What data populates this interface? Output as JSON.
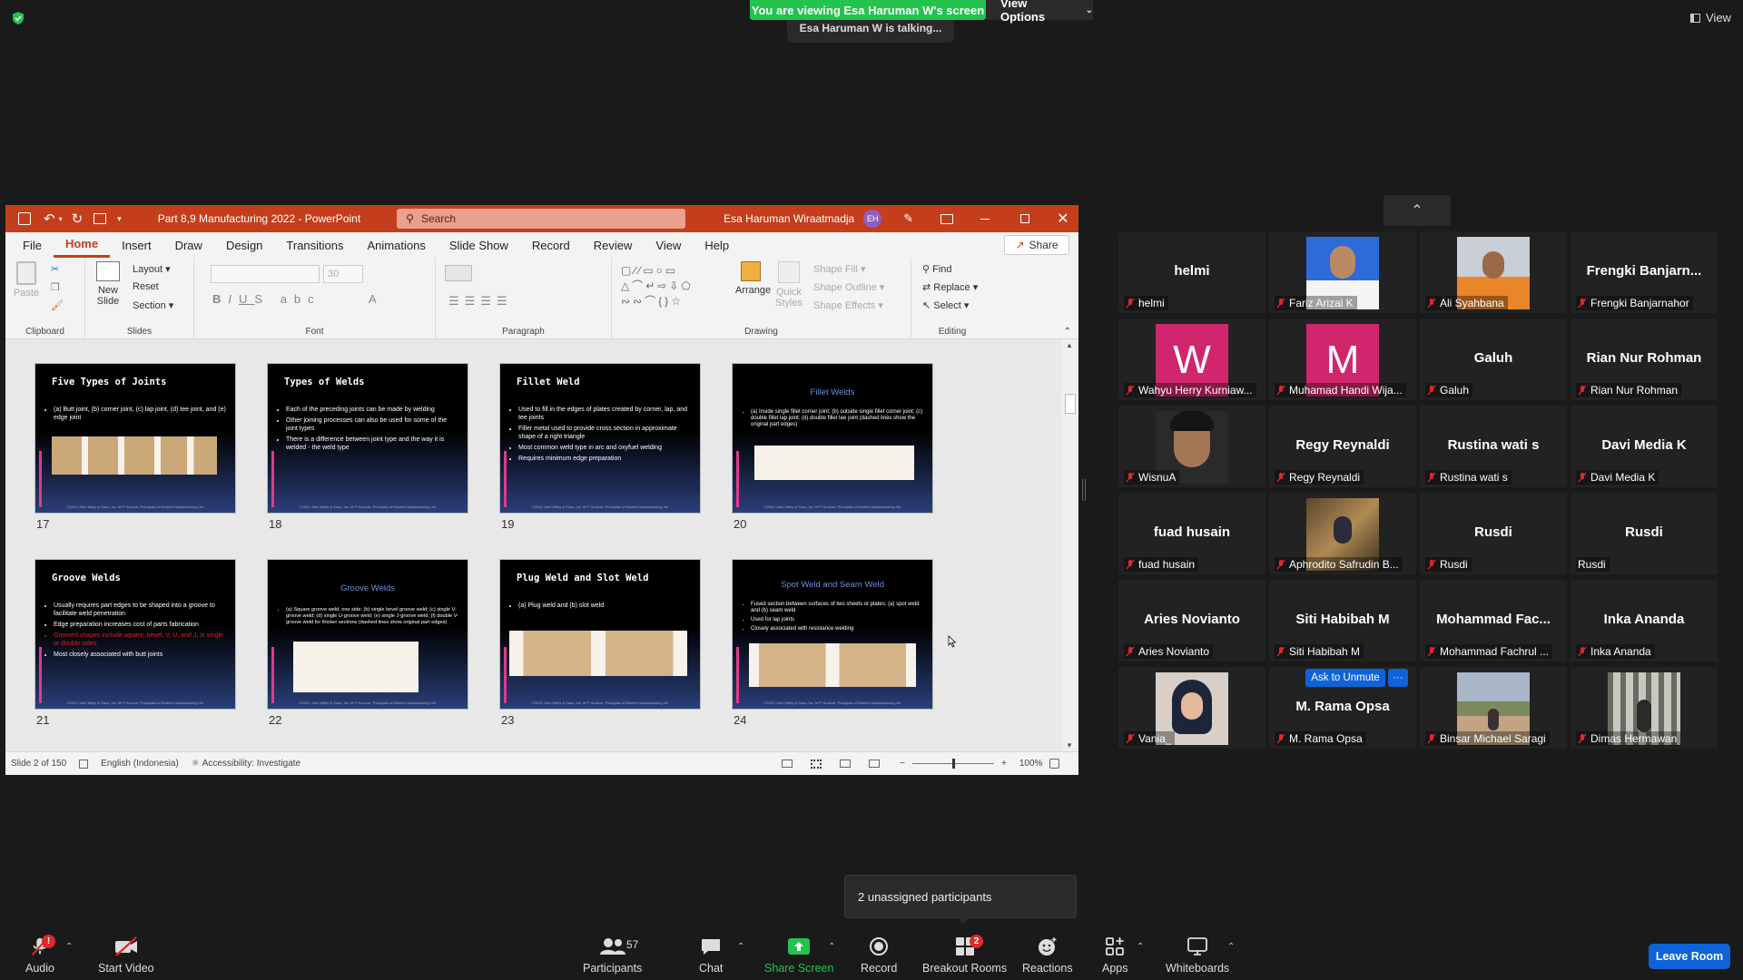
{
  "banner": {
    "viewing": "You are viewing Esa Haruman W's screen",
    "view_options": "View Options",
    "talking": "Esa Haruman W is talking...",
    "view": "View"
  },
  "ppt": {
    "title": "Part 8,9 Manufacturing 2022  -  PowerPoint",
    "search_placeholder": "Search",
    "user": "Esa Haruman Wiraatmadja",
    "user_initials": "EH",
    "tabs": [
      "File",
      "Home",
      "Insert",
      "Draw",
      "Design",
      "Transitions",
      "Animations",
      "Slide Show",
      "Record",
      "Review",
      "View",
      "Help"
    ],
    "share": "Share",
    "groups": {
      "clipboard": "Clipboard",
      "paste": "Paste",
      "slides": "Slides",
      "new_slide": "New",
      "new_slide2": "Slide",
      "layout": "Layout",
      "reset": "Reset",
      "section": "Section",
      "font": "Font",
      "font_size": "30",
      "paragraph": "Paragraph",
      "drawing": "Drawing",
      "arrange": "Arrange",
      "quick_styles": "Quick",
      "quick_styles2": "Styles",
      "shape_fill": "Shape Fill",
      "shape_outline": "Shape Outline",
      "shape_effects": "Shape Effects",
      "editing": "Editing",
      "find": "Find",
      "replace": "Replace",
      "select": "Select"
    },
    "status": {
      "slide": "Slide 2 of 150",
      "language": "English (Indonesia)",
      "accessibility": "Accessibility: Investigate",
      "zoom": "100%"
    },
    "slides": [
      {
        "num": "17",
        "title": "Five Types of Joints",
        "bullets": [
          "(a) Butt joint, (b) corner joint, (c) lap joint, (d) tee joint, and (e) edge joint"
        ]
      },
      {
        "num": "18",
        "title": "Types of Welds",
        "bullets": [
          "Each of the preceding joints can be made by welding",
          "Other joining processes can also be used for some of the joint types",
          "There is a difference between joint type and the way it is welded - the weld type"
        ]
      },
      {
        "num": "19",
        "title": "Fillet Weld",
        "bullets": [
          "Used to fill in the edges of plates created by corner, lap, and tee joints",
          "Filler metal used to provide cross section in approximate shape of a right triangle",
          "Most common weld type in arc and oxyfuel welding",
          "Requires minimum edge preparation"
        ]
      },
      {
        "num": "20",
        "title": "Fillet Welds",
        "bullets": [
          "(a) Inside single fillet corner joint; (b) outside single fillet corner joint; (c) double fillet lap joint; (d) double fillet tee joint (dashed lines show the original part edges)"
        ]
      },
      {
        "num": "21",
        "title": "Groove Welds",
        "bullets": [
          "Usually requires part edges to be shaped into a groove to facilitate weld penetration",
          "Edge preparation increases cost of parts fabrication",
          "Grooved shapes include square, bevel, V, U, and J, in single or double sides",
          "Most closely associated with butt joints"
        ]
      },
      {
        "num": "22",
        "title": "Groove Welds",
        "bullets": [
          "(a) Square groove weld, one side; (b) single bevel groove weld; (c) single V-groove weld; (d) single U-groove weld; (e) single J-groove weld; (f) double V-groove weld for thicker sections (dashed lines show original part edges)"
        ]
      },
      {
        "num": "23",
        "title": "Plug Weld and Slot Weld",
        "bullets": [
          "(a) Plug weld and (b) slot weld"
        ]
      },
      {
        "num": "24",
        "title": "Spot Weld and Seam Weld",
        "bullets": [
          "Fused section between surfaces of two sheets or plates: (a) spot weld and (b) seam weld",
          "Used for lap joints",
          "Closely associated with resistance welding"
        ]
      }
    ],
    "footer": "©2010 John Wiley & Sons, Inc. M P Groover, Principles of Modern Manufacturing 4/e"
  },
  "participants": [
    {
      "name": "helmi",
      "label": "helmi",
      "type": "name"
    },
    {
      "name": "Fariz Arizal K",
      "label": "Fariz Arizal K",
      "type": "photo"
    },
    {
      "name": "Ali Syahbana",
      "label": "Ali Syahbana",
      "type": "photo"
    },
    {
      "name": "Frengki  Banjarn...",
      "label": "Frengki Banjarnahor",
      "type": "name"
    },
    {
      "name": "W",
      "label": "Wahyu Herry Kurniaw...",
      "type": "letter"
    },
    {
      "name": "M",
      "label": "Muhamad Handi Wija...",
      "type": "letter"
    },
    {
      "name": "Galuh",
      "label": "Galuh",
      "type": "name"
    },
    {
      "name": "Rian Nur Rohman",
      "label": "Rian Nur Rohman",
      "type": "name"
    },
    {
      "name": "WisnuA",
      "label": "WisnuA",
      "type": "photo"
    },
    {
      "name": "Regy Reynaldi",
      "label": "Regy Reynaldi",
      "type": "name"
    },
    {
      "name": "Rustina wati s",
      "label": "Rustina wati s",
      "type": "name"
    },
    {
      "name": "Davi Media K",
      "label": "Davi Media K",
      "type": "name"
    },
    {
      "name": "fuad husain",
      "label": "fuad husain",
      "type": "name"
    },
    {
      "name": "Aphrodito Safrudin B...",
      "label": "Aphrodito Safrudin B...",
      "type": "photo"
    },
    {
      "name": "Rusdi",
      "label": "Rusdi",
      "type": "name"
    },
    {
      "name": "Rusdi",
      "label": "Rusdi",
      "type": "name"
    },
    {
      "name": "Aries Novianto",
      "label": "Aries Novianto",
      "type": "name"
    },
    {
      "name": "Siti Habibah M",
      "label": "Siti Habibah M",
      "type": "name"
    },
    {
      "name": "Mohammad  Fac...",
      "label": "Mohammad Fachrul ...",
      "type": "name"
    },
    {
      "name": "Inka Ananda",
      "label": "Inka Ananda",
      "type": "name"
    },
    {
      "name": "Vania_",
      "label": "Vania_",
      "type": "photo"
    },
    {
      "name": "M. Rama Opsa",
      "label": "M. Rama Opsa",
      "type": "name"
    },
    {
      "name": "Binsar Michael Saragi",
      "label": "Binsar Michael Saragi",
      "type": "photo"
    },
    {
      "name": "Dimas Hermawan",
      "label": "Dimas Hermawan",
      "type": "photo"
    }
  ],
  "ask_to_unmute": "Ask to Unmute",
  "more_dots": "···",
  "unassigned": "2 unassigned participants",
  "toolbar": {
    "audio": "Audio",
    "audio_badge": "!",
    "start_video": "Start Video",
    "participants": "Participants",
    "participants_count": "57",
    "chat": "Chat",
    "share_screen": "Share Screen",
    "record": "Record",
    "breakout": "Breakout Rooms",
    "breakout_badge": "2",
    "reactions": "Reactions",
    "apps": "Apps",
    "whiteboards": "Whiteboards",
    "leave": "Leave Room"
  },
  "colors": {
    "zoom_green": "#23c34e",
    "ppt_red": "#c43e1c",
    "leave_blue": "#0e63d8",
    "mute_red": "#e02828"
  }
}
